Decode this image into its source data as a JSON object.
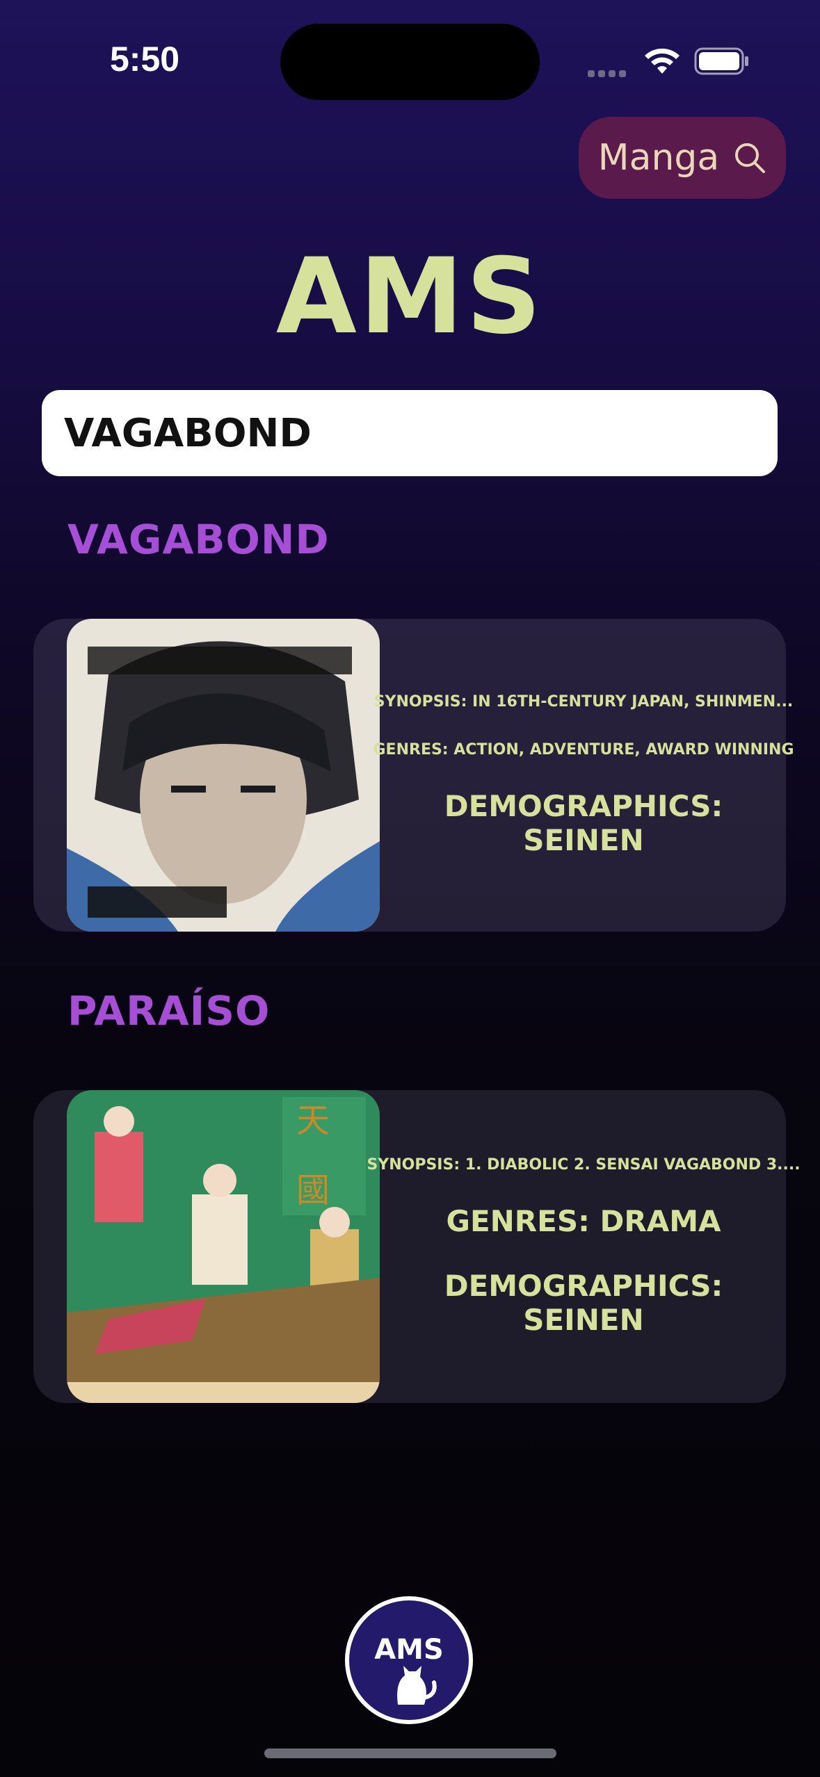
{
  "status_bar": {
    "time": "5:50"
  },
  "search_pill": {
    "label": "Manga"
  },
  "app": {
    "title": "AMS"
  },
  "search": {
    "value": "VAGABOND"
  },
  "results": [
    {
      "title": "VAGABOND",
      "synopsis": "SYNOPSIS: IN 16TH-CENTURY JAPAN, SHINMEN...",
      "genres": "GENRES: ACTION, ADVENTURE, AWARD WINNING",
      "demographics": "DEMOGRAPHICS: SEINEN"
    },
    {
      "title": "PARAÍSO",
      "synopsis": "SYNOPSIS: 1. DIABOLIC 2. SENSAI VAGABOND 3....",
      "genres": "GENRES: DRAMA",
      "demographics": "DEMOGRAPHICS: SEINEN"
    }
  ],
  "home_button": {
    "label": "AMS"
  },
  "colors": {
    "accent_title": "#d6e29c",
    "section_title": "#a64fd6",
    "pill_bg": "#5a1a4c"
  }
}
